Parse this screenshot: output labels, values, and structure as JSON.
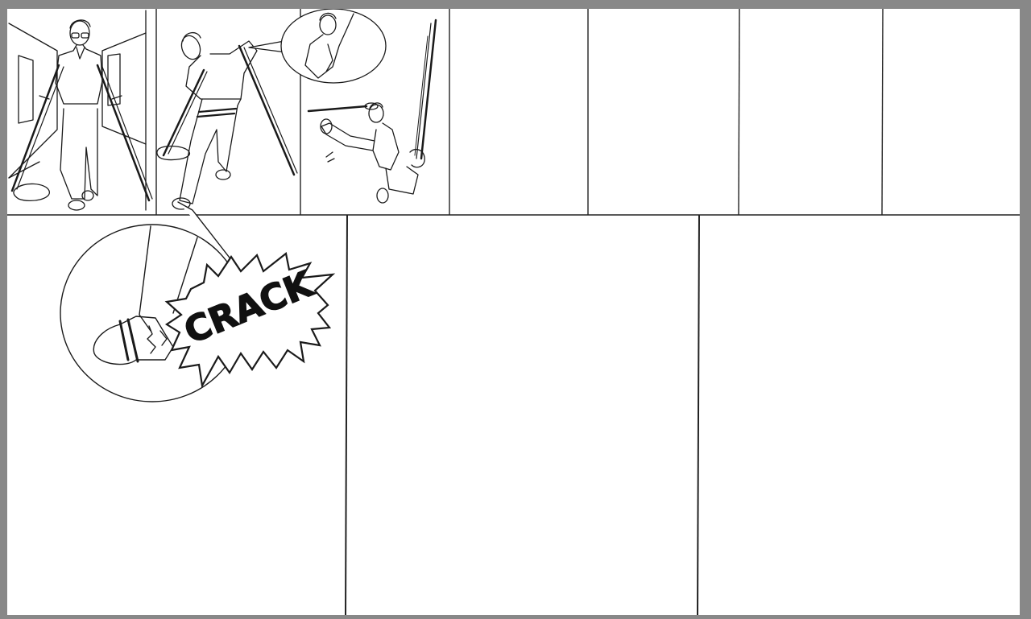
{
  "page": {
    "background_color": "#888888",
    "paper_color": "#ffffff",
    "ink_color": "#1a1a1a"
  },
  "sound_effect": {
    "text": "CRACK"
  },
  "panels": {
    "top_row_count": 8,
    "bottom_row_count": 3
  }
}
